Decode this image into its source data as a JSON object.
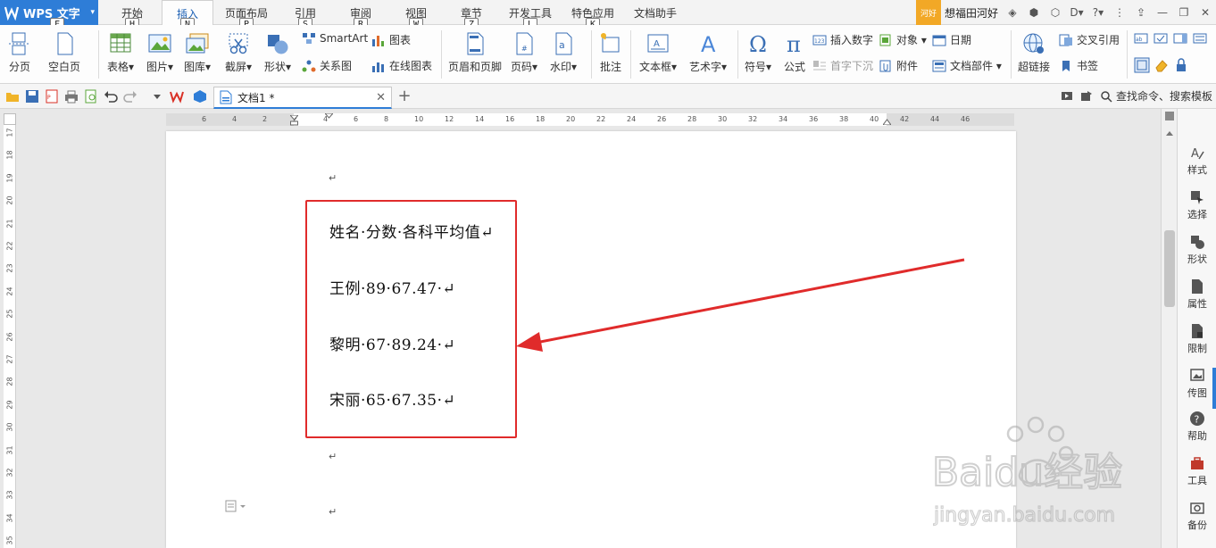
{
  "app": {
    "name": "WPS 文字"
  },
  "menu": {
    "tabs": [
      "开始",
      "插入",
      "页面布局",
      "引用",
      "审阅",
      "视图",
      "章节",
      "开发工具",
      "特色应用",
      "文档助手"
    ],
    "active_tab": "插入",
    "keytips": [
      "F",
      "H",
      "N",
      "P",
      "S",
      "R",
      "W",
      "Z",
      "L",
      "K"
    ]
  },
  "user": {
    "badge": "河好",
    "name": "想福田河好"
  },
  "ribbon": {
    "page_break": "分页",
    "blank_page": "空白页",
    "table": "表格",
    "picture": "图片",
    "gallery": "图库",
    "screenshot": "截屏",
    "shape": "形状",
    "smartart": "SmartArt",
    "chart": "图表",
    "relation_chart": "关系图",
    "online_chart": "在线图表",
    "header_footer": "页眉和页脚",
    "page_number": "页码",
    "watermark": "水印",
    "comment": "批注",
    "textbox": "文本框",
    "wordart": "艺术字",
    "symbol": "符号",
    "formula": "公式",
    "insert_number": "插入数字",
    "drop_cap": "首字下沉",
    "object": "对象",
    "attachment": "附件",
    "date": "日期",
    "doc_parts": "文档部件",
    "hyperlink": "超链接",
    "cross_ref": "交叉引用",
    "bookmark": "书签"
  },
  "doc_tab": {
    "title": "文档1 *"
  },
  "search": {
    "label": "查找命令、搜索模板"
  },
  "ruler": {
    "h_labels": [
      "6",
      "4",
      "2",
      "2",
      "4",
      "6",
      "8",
      "10",
      "12",
      "14",
      "16",
      "18",
      "20",
      "22",
      "24",
      "26",
      "28",
      "30",
      "32",
      "34",
      "36",
      "38",
      "40",
      "42",
      "44",
      "46"
    ],
    "v_labels": [
      "17",
      "18",
      "19",
      "20",
      "21",
      "22",
      "23",
      "24",
      "25",
      "26",
      "27",
      "28",
      "29",
      "30",
      "31",
      "32",
      "33",
      "34",
      "35"
    ]
  },
  "document": {
    "lines": [
      "姓名·分数·各科平均值↵",
      "王例·89·67.47·↵",
      "黎明·67·89.24·↵",
      "宋丽·65·67.35·↵"
    ],
    "para_mark": "↵"
  },
  "sidepanel": {
    "items": [
      "样式",
      "选择",
      "形状",
      "属性",
      "限制",
      "传图",
      "帮助",
      "工具",
      "备份"
    ]
  },
  "watermark": {
    "text1": "Baidu经验",
    "text2": "jingyan.baidu.com"
  },
  "colors": {
    "brand": "#2e7dd7",
    "highlight": "#e02b2b",
    "badge": "#f2a826"
  }
}
